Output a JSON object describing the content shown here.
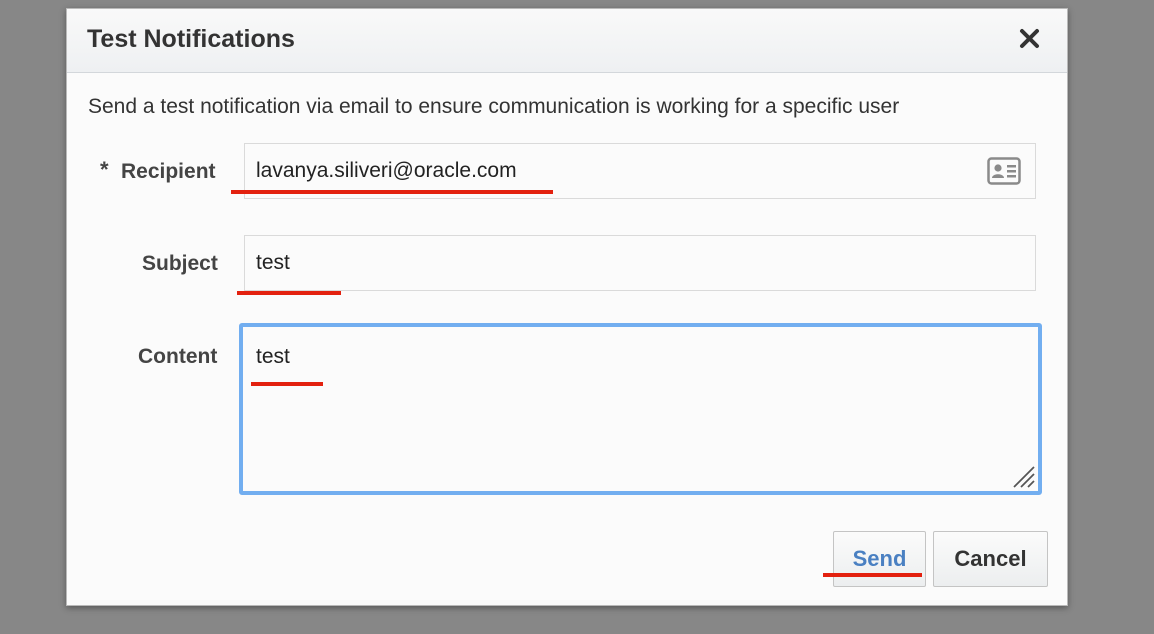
{
  "dialog": {
    "title": "Test Notifications",
    "description": "Send a test notification via email to ensure communication is working for a specific user"
  },
  "form": {
    "required_marker": "*",
    "recipient": {
      "label": "Recipient",
      "value": "lavanya.siliveri@oracle.com"
    },
    "subject": {
      "label": "Subject",
      "value": "test"
    },
    "content": {
      "label": "Content",
      "value": "test"
    }
  },
  "buttons": {
    "send_label": "Send",
    "cancel_label": "Cancel"
  },
  "icons": {
    "close": "close-icon",
    "contact_picker": "contact-card-icon",
    "resize": "resize-grip-icon"
  },
  "colors": {
    "annotation_red": "#e3210f",
    "focus_blue": "#72aef0",
    "send_blue": "#4a80c2"
  }
}
